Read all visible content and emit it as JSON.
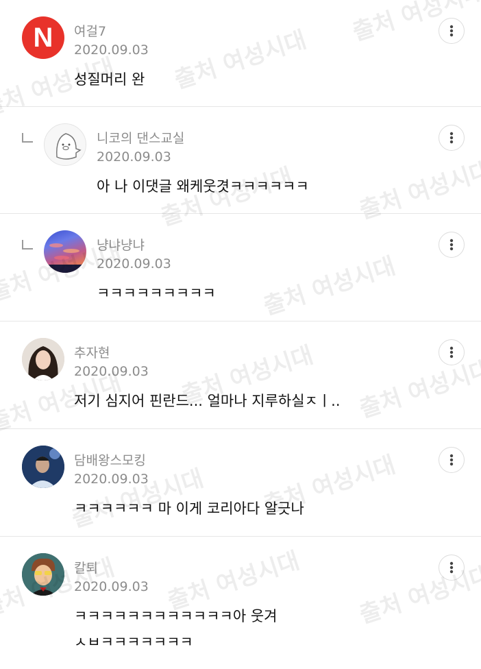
{
  "watermark": "출처 여성시대",
  "comments": [
    {
      "name": "여걸7",
      "date": "2020.09.03",
      "text": "성질머리 완",
      "avatar_letter": "N"
    },
    {
      "name": "니코의 댄스교실",
      "date": "2020.09.03",
      "text": "아 나 이댓글 왜케웃겻ㅋㅋㅋㅋㅋㅋ"
    },
    {
      "name": "냥냐냥냐",
      "date": "2020.09.03",
      "text": "ㅋㅋㅋㅋㅋㅋㅋㅋㅋ"
    },
    {
      "name": "추자현",
      "date": "2020.09.03",
      "text": "저기 심지어 핀란드... 얼마나 지루하실ㅈㅣ.."
    },
    {
      "name": "담배왕스모킹",
      "date": "2020.09.03",
      "text": "ㅋㅋㅋㅋㅋㅋ 마 이게 코리아다 알긋나"
    },
    {
      "name": "칼퇴",
      "date": "2020.09.03",
      "text_line1": "ㅋㅋㅋㅋㅋㅋㅋㅋㅋㅋㅋㅋ아 웃겨",
      "text_line2": "ㅅㅂㅋㅋㅋㅋㅋㅋㅋ"
    }
  ]
}
